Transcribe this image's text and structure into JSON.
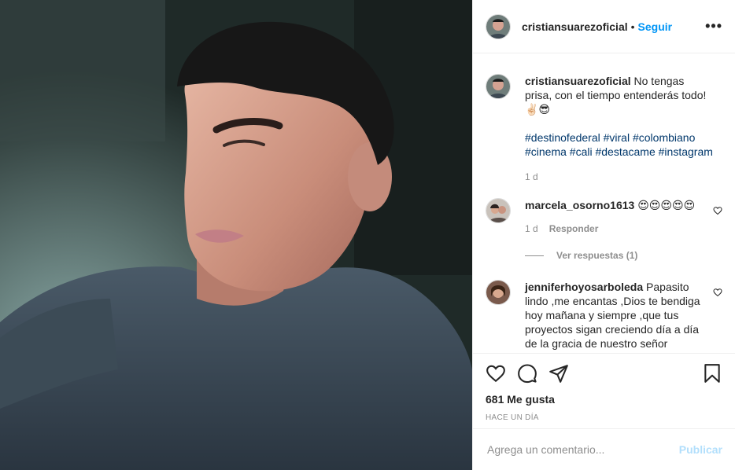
{
  "post": {
    "username": "cristiansuarezoficial",
    "follow_label": "Seguir",
    "separator": "•",
    "more_label": "•••",
    "caption": "No tengas prisa, con el tiempo entenderás todo! ✌🏻😎",
    "hashtags": "#destinofederal #viral #colombiano #cinema #cali #destacame #instagram",
    "caption_age": "1 d"
  },
  "comments": [
    {
      "username": "marcela_osorno1613",
      "text": "😍😍😍😍😍",
      "age": "1 d",
      "reply_label": "Responder",
      "view_replies_label": "Ver respuestas (1)"
    },
    {
      "username": "jenniferhoyosarboleda",
      "text": "Papasito lindo ,me encantas ,Dios te bendiga hoy mañana y siempre ,que tus proyectos sigan creciendo día a día de la gracia de nuestro señor Jesucristo..."
    }
  ],
  "actions": {
    "icons": [
      "heart-icon",
      "comment-icon",
      "share-icon",
      "bookmark-icon"
    ],
    "likes_label": "681 Me gusta",
    "timestamp": "HACE UN DÍA"
  },
  "comment_box": {
    "placeholder": "Agrega un comentario...",
    "post_label": "Publicar"
  },
  "colors": {
    "link": "#0095f6",
    "hashtag": "#00376b",
    "muted": "#8e8e8e",
    "post_disabled": "#b2dffc"
  }
}
